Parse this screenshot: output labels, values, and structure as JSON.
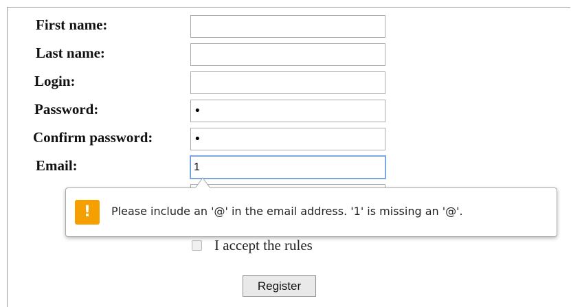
{
  "form": {
    "first_name": {
      "label": "First name:",
      "value": ""
    },
    "last_name": {
      "label": "Last name:",
      "value": ""
    },
    "login": {
      "label": "Login:",
      "value": ""
    },
    "password": {
      "label": "Password:",
      "value": "•"
    },
    "confirm_password": {
      "label": "Confirm password:",
      "value": "•"
    },
    "email": {
      "label": "Email:",
      "value": "1"
    },
    "accept_rules": {
      "label": "I accept the rules",
      "checked": false
    },
    "register_label": "Register"
  },
  "validation": {
    "message": "Please include an '@' in the email address. '1' is missing an '@'.",
    "icon": "warning-icon",
    "icon_glyph": "!",
    "icon_color": "#f5a000"
  }
}
